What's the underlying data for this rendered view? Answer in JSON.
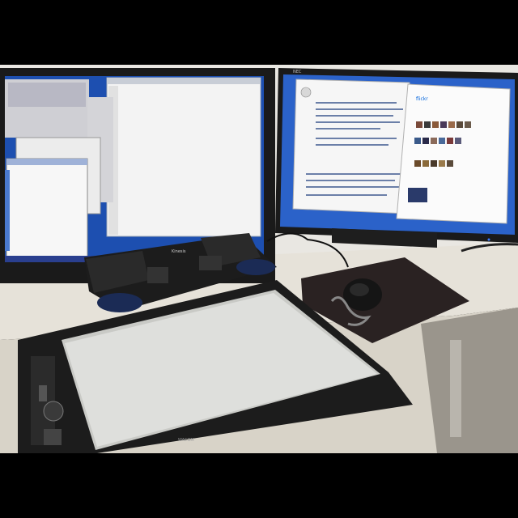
{
  "photo": {
    "left_monitor": {
      "title_bar_text": "",
      "taskbar_color": "#2a3f8f",
      "desktop_color": "#1d4fb0"
    },
    "right_monitor": {
      "brand_label": "NEC",
      "browser_left_logo": "Wikipedia",
      "browser_right_logo": "flickr",
      "desktop_color": "#2b62c9"
    },
    "keyboard": {
      "brand_label": "Kinesis"
    },
    "tablet": {
      "brand_label": "WACOM"
    },
    "colors": {
      "background": "#000000",
      "wall": "#e9e7e2",
      "desk": "#e6e2d9",
      "bezel": "#1a1a1a",
      "mousepad": "#2a2222"
    }
  }
}
